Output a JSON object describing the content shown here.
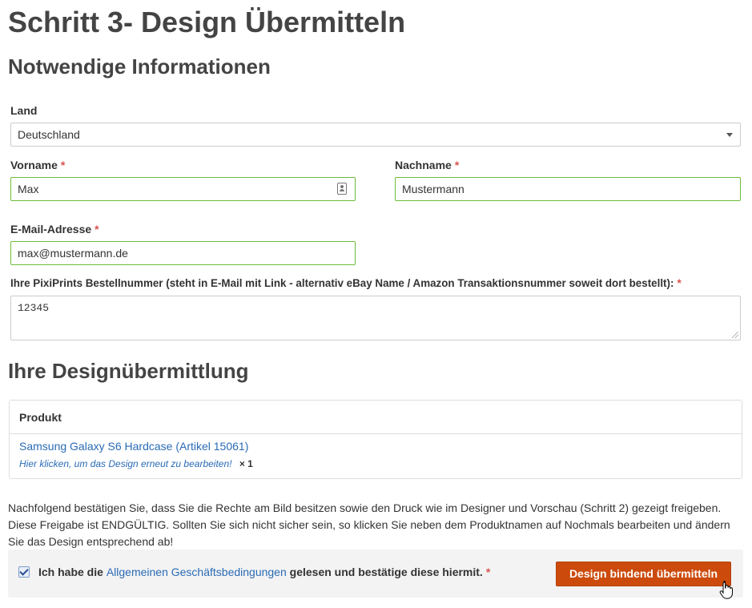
{
  "page": {
    "title": "Schritt 3- Design Übermitteln"
  },
  "info": {
    "heading": "Notwendige Informationen",
    "land": {
      "label": "Land",
      "value": "Deutschland"
    },
    "vorname": {
      "label": "Vorname",
      "value": "Max"
    },
    "nachname": {
      "label": "Nachname",
      "value": "Mustermann"
    },
    "email": {
      "label": "E-Mail-Adresse",
      "value": "max@mustermann.de"
    },
    "order": {
      "label": "Ihre PixiPrints Bestellnummer (steht in E-Mail mit Link - alternativ eBay Name / Amazon Transaktionsnummer soweit dort bestellt):",
      "value": "12345"
    },
    "required_mark": "*"
  },
  "design": {
    "heading": "Ihre Designübermittlung",
    "table_header": "Produkt",
    "product_name": "Samsung Galaxy S6 Hardcase (Artikel 15061)",
    "edit_link": "Hier klicken, um das Design erneut zu bearbeiten!",
    "quantity": "× 1"
  },
  "notice": "Nachfolgend bestätigen Sie, dass Sie die Rechte am Bild besitzen sowie den Druck wie im Designer und Vorschau (Schritt 2) gezeigt freigeben. Diese Freigabe ist ENDGÜLTIG. Sollten Sie sich nicht sicher sein, so klicken Sie neben dem Produktnamen auf Nochmals bearbeiten und ändern Sie das Design entsprechend ab!",
  "confirm": {
    "checked": true,
    "text_before": "Ich habe die",
    "terms_link": "Allgemeinen Geschäftsbedingungen",
    "text_after": "gelesen und bestätige diese hiermit.",
    "submit_label": "Design bindend übermitteln"
  },
  "colors": {
    "valid_border": "#6dbb3b",
    "link": "#2a6bb5",
    "required": "#d9534f",
    "submit_bg": "#cc4b0c"
  }
}
